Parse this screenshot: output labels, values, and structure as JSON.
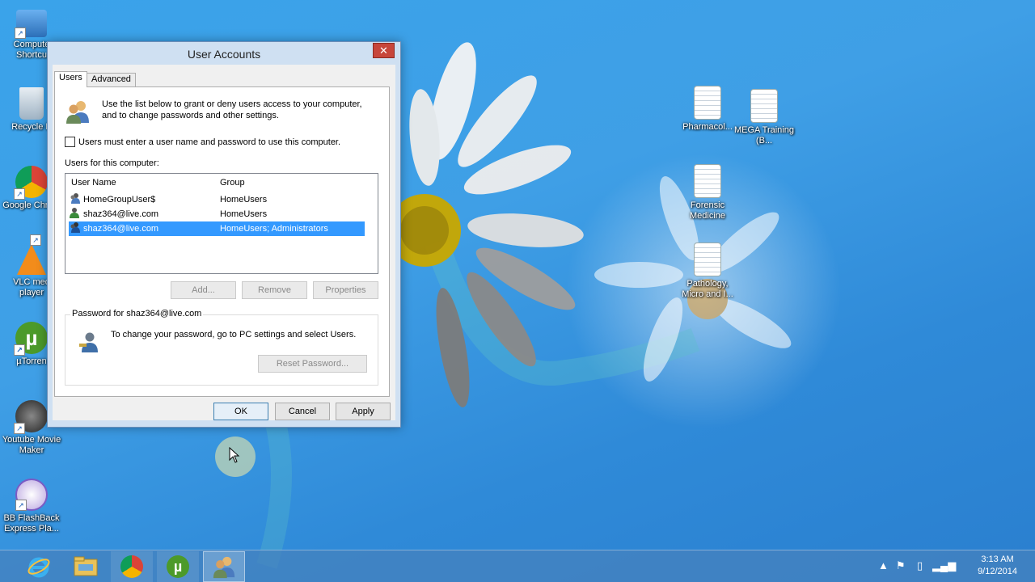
{
  "desktop": {
    "left_icons": [
      {
        "label": "Compute Shortcu",
        "icon": "computer-icon"
      },
      {
        "label": "Recycle B",
        "icon": "recycle-bin-icon"
      },
      {
        "label": "Google Chrom",
        "icon": "chrome-icon"
      },
      {
        "label": "VLC med player",
        "icon": "vlc-icon"
      },
      {
        "label": "µTorren",
        "icon": "utorrent-icon"
      },
      {
        "label": "Youtube Movie Maker",
        "icon": "youtube-movie-maker-icon"
      },
      {
        "label": "BB FlashBack Express Pla...",
        "icon": "flashback-icon"
      }
    ],
    "right_icons": [
      {
        "label": "Pharmacol...",
        "icon": "document-icon"
      },
      {
        "label": "MEGA Training (B...",
        "icon": "document-icon"
      },
      {
        "label": "Forensic Medicine",
        "icon": "document-icon"
      },
      {
        "label": "Pathology, Micro and I...",
        "icon": "document-icon"
      }
    ]
  },
  "dialog": {
    "title": "User Accounts",
    "close_glyph": "✕",
    "tabs": [
      "Users",
      "Advanced"
    ],
    "intro_line1": "Use the list below to grant or deny users access to your computer,",
    "intro_line2": "and to change passwords and other settings.",
    "checkbox_label": "Users must enter a user name and password to use this computer.",
    "checkbox_checked": false,
    "users_label": "Users for this computer:",
    "columns": [
      "User Name",
      "Group"
    ],
    "rows": [
      {
        "user": "HomeGroupUser$",
        "group": "HomeUsers",
        "selected": false
      },
      {
        "user": "shaz364@live.com",
        "group": "HomeUsers",
        "selected": false
      },
      {
        "user": "shaz364@live.com",
        "group": "HomeUsers; Administrators",
        "selected": true
      }
    ],
    "add_button": "Add...",
    "remove_button": "Remove",
    "properties_button": "Properties",
    "password_group_title": "Password for shaz364@live.com",
    "password_text": "To change your password, go to PC settings and select Users.",
    "reset_button": "Reset Password...",
    "ok_button": "OK",
    "cancel_button": "Cancel",
    "apply_button": "Apply"
  },
  "taskbar": {
    "apps": [
      "internet-explorer-icon",
      "file-explorer-icon",
      "chrome-icon",
      "utorrent-icon",
      "user-accounts-icon"
    ],
    "time": "3:13 AM",
    "date": "9/12/2014"
  },
  "colors": {
    "selection": "#3399ff",
    "close_button": "#c7463b",
    "desktop_blue": "#3aa3ea"
  }
}
